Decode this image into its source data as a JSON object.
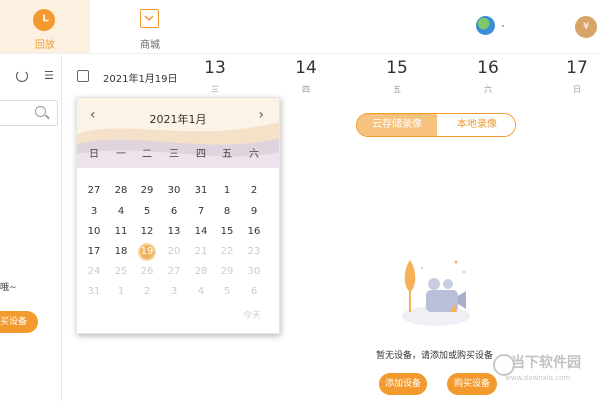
{
  "nav": {
    "playback_label": "回放",
    "shop_label": "商城",
    "coin_symbol": "¥",
    "accent_color": "#f29a2e"
  },
  "sidebar": {
    "empty_text_fragment": "哦~",
    "buy_fragment": "买设备"
  },
  "date_picker": {
    "value": "2021年1月19日"
  },
  "day_strip": [
    {
      "num": "13",
      "weekday": "三"
    },
    {
      "num": "14",
      "weekday": "四"
    },
    {
      "num": "15",
      "weekday": "五"
    },
    {
      "num": "16",
      "weekday": "六"
    },
    {
      "num": "17",
      "weekday": "日"
    }
  ],
  "calendar": {
    "title": "2021年1月",
    "prev_arrow": "‹",
    "next_arrow": "›",
    "weekdays": [
      "日",
      "一",
      "二",
      "三",
      "四",
      "五",
      "六"
    ],
    "weeks": [
      [
        "27",
        "28",
        "29",
        "30",
        "31",
        "1",
        "2"
      ],
      [
        "3",
        "4",
        "5",
        "6",
        "7",
        "8",
        "9"
      ],
      [
        "10",
        "11",
        "12",
        "13",
        "14",
        "15",
        "16"
      ],
      [
        "17",
        "18",
        "19",
        "20",
        "21",
        "22",
        "23"
      ],
      [
        "24",
        "25",
        "26",
        "27",
        "28",
        "29",
        "30"
      ],
      [
        "31",
        "1",
        "2",
        "3",
        "4",
        "5",
        "6"
      ]
    ],
    "selected": "19",
    "today_label": "今天"
  },
  "record_toggle": {
    "cloud_label": "云存储录像",
    "local_label": "本地录像",
    "active": "cloud"
  },
  "empty_state": {
    "message": "暂无设备，请添加或购买设备",
    "add_label": "添加设备",
    "buy_label": "购买设备"
  },
  "watermark": {
    "title": "当下软件园",
    "url": "www.downxia.com"
  }
}
